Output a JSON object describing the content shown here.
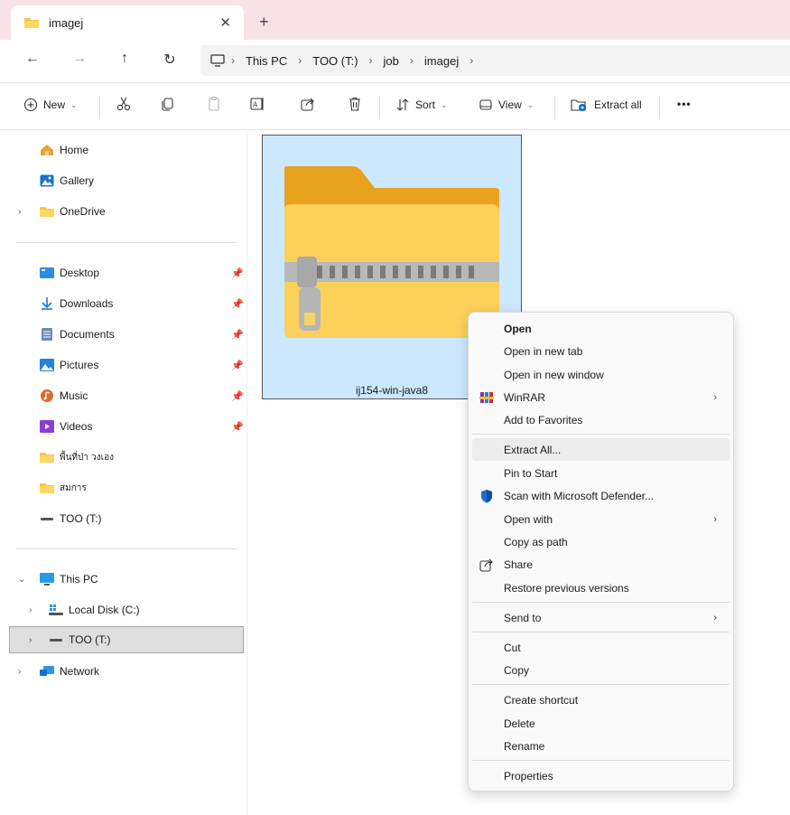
{
  "tab": {
    "title": "imagej",
    "close": "✕",
    "new": "+"
  },
  "nav": {
    "back": "←",
    "forward": "→",
    "up": "↑",
    "refresh": "↻"
  },
  "address": {
    "crumbs": [
      "This PC",
      "TOO (T:)",
      "job",
      "imagej"
    ],
    "sep": "›"
  },
  "toolbar": {
    "new_label": "New",
    "sort_label": "Sort",
    "view_label": "View",
    "extract_label": "Extract all",
    "more": "•••"
  },
  "sidebar": {
    "home": "Home",
    "gallery": "Gallery",
    "onedrive": "OneDrive",
    "desktop": "Desktop",
    "downloads": "Downloads",
    "documents": "Documents",
    "pictures": "Pictures",
    "music": "Music",
    "videos": "Videos",
    "folder_thai_1": "พื้นที่ป่า วงเอง",
    "folder_thai_2": "สมการ",
    "too_drive": "TOO (T:)",
    "this_pc": "This PC",
    "local_disk": "Local Disk (C:)",
    "too_drive_tree": "TOO (T:)",
    "network": "Network"
  },
  "file": {
    "name": "ij154-win-java8"
  },
  "context_menu": {
    "open": "Open",
    "open_new_tab": "Open in new tab",
    "open_new_window": "Open in new window",
    "winrar": "WinRAR",
    "add_favorites": "Add to Favorites",
    "extract_all": "Extract All...",
    "pin_start": "Pin to Start",
    "scan_defender": "Scan with Microsoft Defender...",
    "open_with": "Open with",
    "copy_path": "Copy as path",
    "share": "Share",
    "restore_versions": "Restore previous versions",
    "send_to": "Send to",
    "cut": "Cut",
    "copy": "Copy",
    "create_shortcut": "Create shortcut",
    "delete": "Delete",
    "rename": "Rename",
    "properties": "Properties",
    "submenu_arrow": "›"
  },
  "colors": {
    "tab_strip": "#f7e3e6",
    "selection": "#cce8ff",
    "folder": "#f6c744",
    "accent": "#0067c0"
  }
}
